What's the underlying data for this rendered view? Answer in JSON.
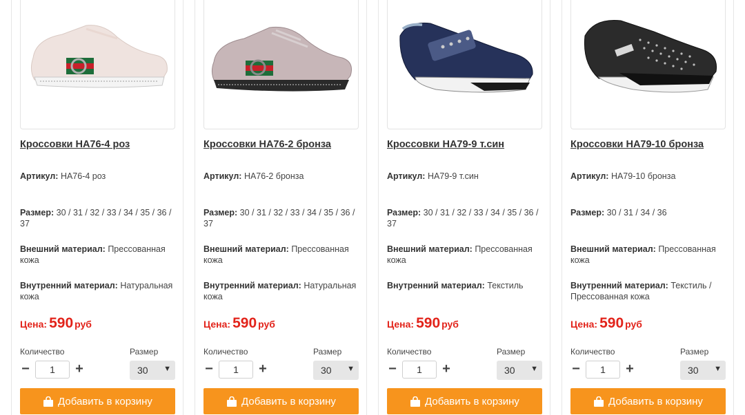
{
  "labels": {
    "article": "Артикул:",
    "size": "Размер:",
    "outer": "Внешний материал:",
    "inner": "Внутренний материал:",
    "price": "Цена:",
    "currency": "руб",
    "quantity": "Количество",
    "size_select": "Размер",
    "add_to_cart": "Добавить в корзину"
  },
  "colors": {
    "price": "#e2231a",
    "cart_button": "#f7941d"
  },
  "products": [
    {
      "title": "Кроссовки НА76-4 роз",
      "article": "НА76-4 роз",
      "sizes": "30 / 31 / 32 / 33 / 34 / 35 / 36 / 37",
      "outer": "Прессованная кожа",
      "inner": "Натуральная кожа",
      "price": "590",
      "qty": "1",
      "size_selected": "30"
    },
    {
      "title": "Кроссовки НА76-2 бронза",
      "article": "НА76-2 бронза",
      "sizes": "30 / 31 / 32 / 33 / 34 / 35 / 36 / 37",
      "outer": "Прессованная кожа",
      "inner": "Натуральная кожа",
      "price": "590",
      "qty": "1",
      "size_selected": "30"
    },
    {
      "title": "Кроссовки НА79-9 т.син",
      "article": "НА79-9 т.син",
      "sizes": "30 / 31 / 32 / 33 / 34 / 35 / 36 / 37",
      "outer": "Прессованная кожа",
      "inner": "Текстиль",
      "price": "590",
      "qty": "1",
      "size_selected": "30"
    },
    {
      "title": "Кроссовки НА79-10 бронза",
      "article": "НА79-10 бронза",
      "sizes": "30 / 31 / 34 / 36",
      "outer": "Прессованная кожа",
      "inner": "Текстиль / Прессованная кожа",
      "price": "590",
      "qty": "1",
      "size_selected": "30"
    }
  ]
}
